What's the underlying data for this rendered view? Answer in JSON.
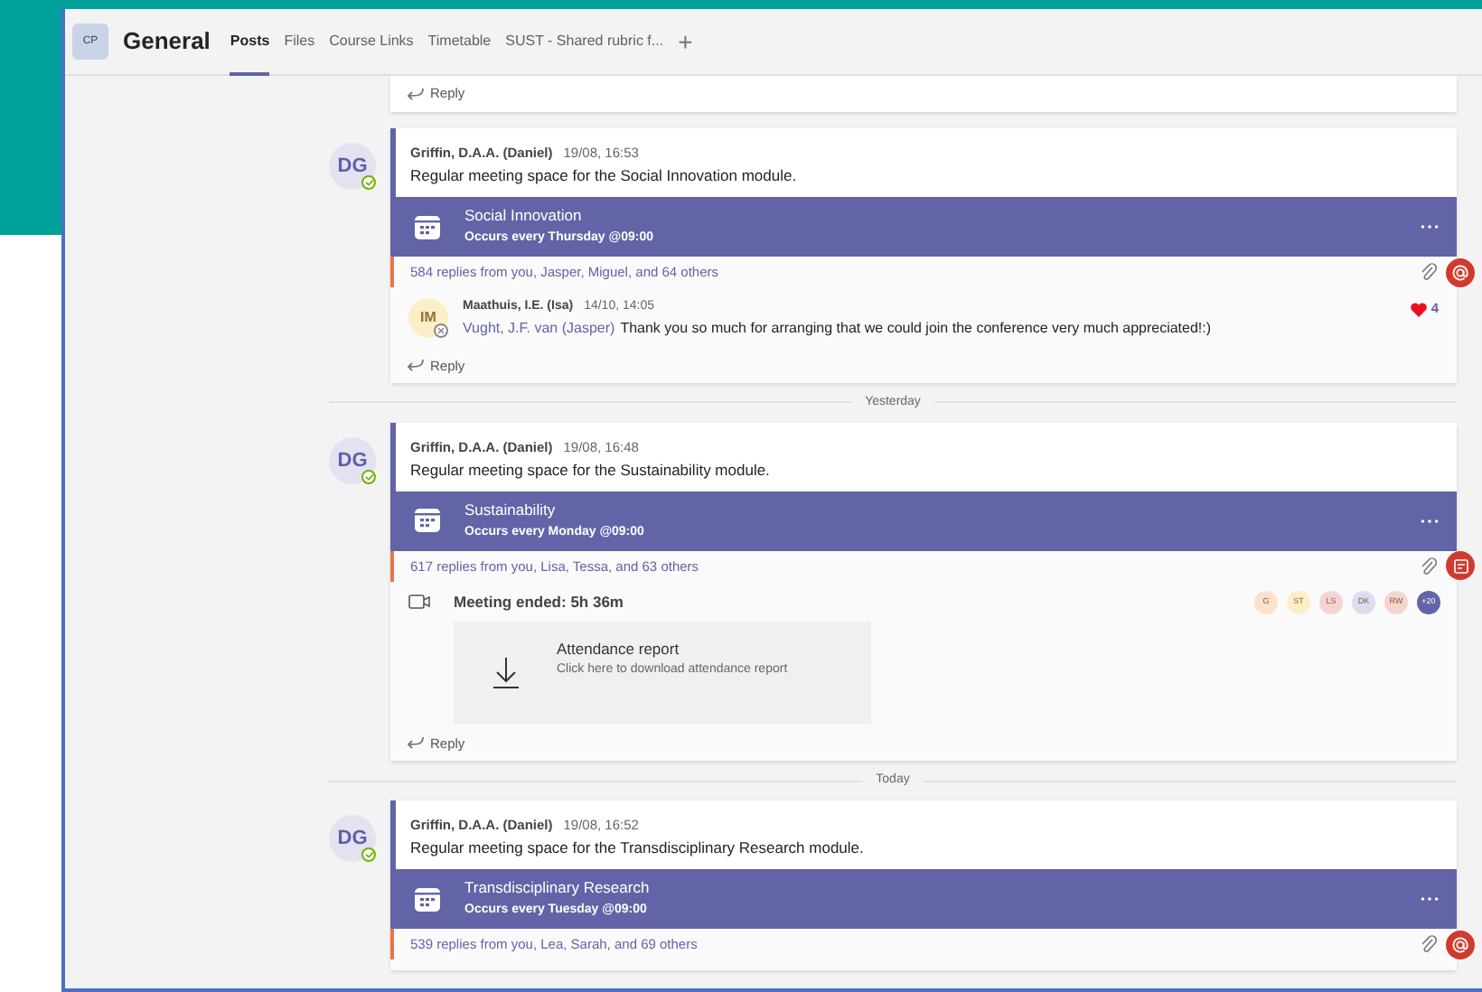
{
  "header": {
    "badge": "CP",
    "title": "General",
    "tabs": [
      {
        "label": "Posts",
        "selected": true
      },
      {
        "label": "Files",
        "selected": false
      },
      {
        "label": "Course Links",
        "selected": false
      },
      {
        "label": "Timetable",
        "selected": false
      },
      {
        "label": "SUST - Shared rubric f...",
        "selected": false
      }
    ],
    "add": "+"
  },
  "top_reply": "Reply",
  "feed": [
    {
      "kind": "thread",
      "avatar": "DG",
      "presence": {
        "kind": "available"
      },
      "author": "Griffin, D.A.A. (Daniel)",
      "time": "19/08, 16:53",
      "body": "Regular meeting space for the Social Innovation module.",
      "meeting": {
        "title": "Social Innovation",
        "schedule": "Occurs every Thursday @09:00"
      },
      "summary": "584 replies from you, Jasper, Miguel, and 64 others",
      "badge": {
        "kind": "mention"
      },
      "replies": [
        {
          "avatar": "IM",
          "presence": {
            "kind": "offline"
          },
          "author": "Maathuis, I.E. (Isa)",
          "time": "14/10, 14:05",
          "mention": "Vught, J.F. van (Jasper)",
          "text": "Thank you so much for arranging that we could join the conference very much appreciated!:)",
          "likes": "4"
        }
      ],
      "reply": "Reply"
    },
    {
      "kind": "divider",
      "label": "Yesterday"
    },
    {
      "kind": "thread",
      "avatar": "DG",
      "presence": {
        "kind": "available"
      },
      "author": "Griffin, D.A.A. (Daniel)",
      "time": "19/08, 16:48",
      "body": "Regular meeting space for the Sustainability module.",
      "meeting": {
        "title": "Sustainability",
        "schedule": "Occurs every Monday @09:00"
      },
      "summary": "617 replies from you, Lisa, Tessa, and 63 others",
      "badge": {
        "kind": "notes"
      },
      "ended": {
        "title": "Meeting ended: 5h 36m",
        "participants": [
          {
            "initials": "G",
            "color": "#fbe2cc"
          },
          {
            "initials": "ST",
            "color": "#fcefc7"
          },
          {
            "initials": "LS",
            "color": "#f6d3d3"
          },
          {
            "initials": "DK",
            "color": "#dedcf0"
          },
          {
            "initials": "RW",
            "color": "#f5d6cc"
          },
          {
            "initials": "+20",
            "color": "#6264a7"
          }
        ],
        "report": {
          "title": "Attendance report",
          "subtitle": "Click here to download attendance report"
        }
      },
      "reply": "Reply"
    },
    {
      "kind": "divider",
      "label": "Today"
    },
    {
      "kind": "thread",
      "avatar": "DG",
      "presence": {
        "kind": "available"
      },
      "author": "Griffin, D.A.A. (Daniel)",
      "time": "19/08, 16:52",
      "body": "Regular meeting space for the Transdisciplinary Research module.",
      "meeting": {
        "title": "Transdisciplinary Research",
        "schedule": "Occurs every Tuesday @09:00"
      },
      "summary": "539 replies from you, Lea, Sarah, and 69 others",
      "badge": {
        "kind": "mention"
      }
    }
  ]
}
